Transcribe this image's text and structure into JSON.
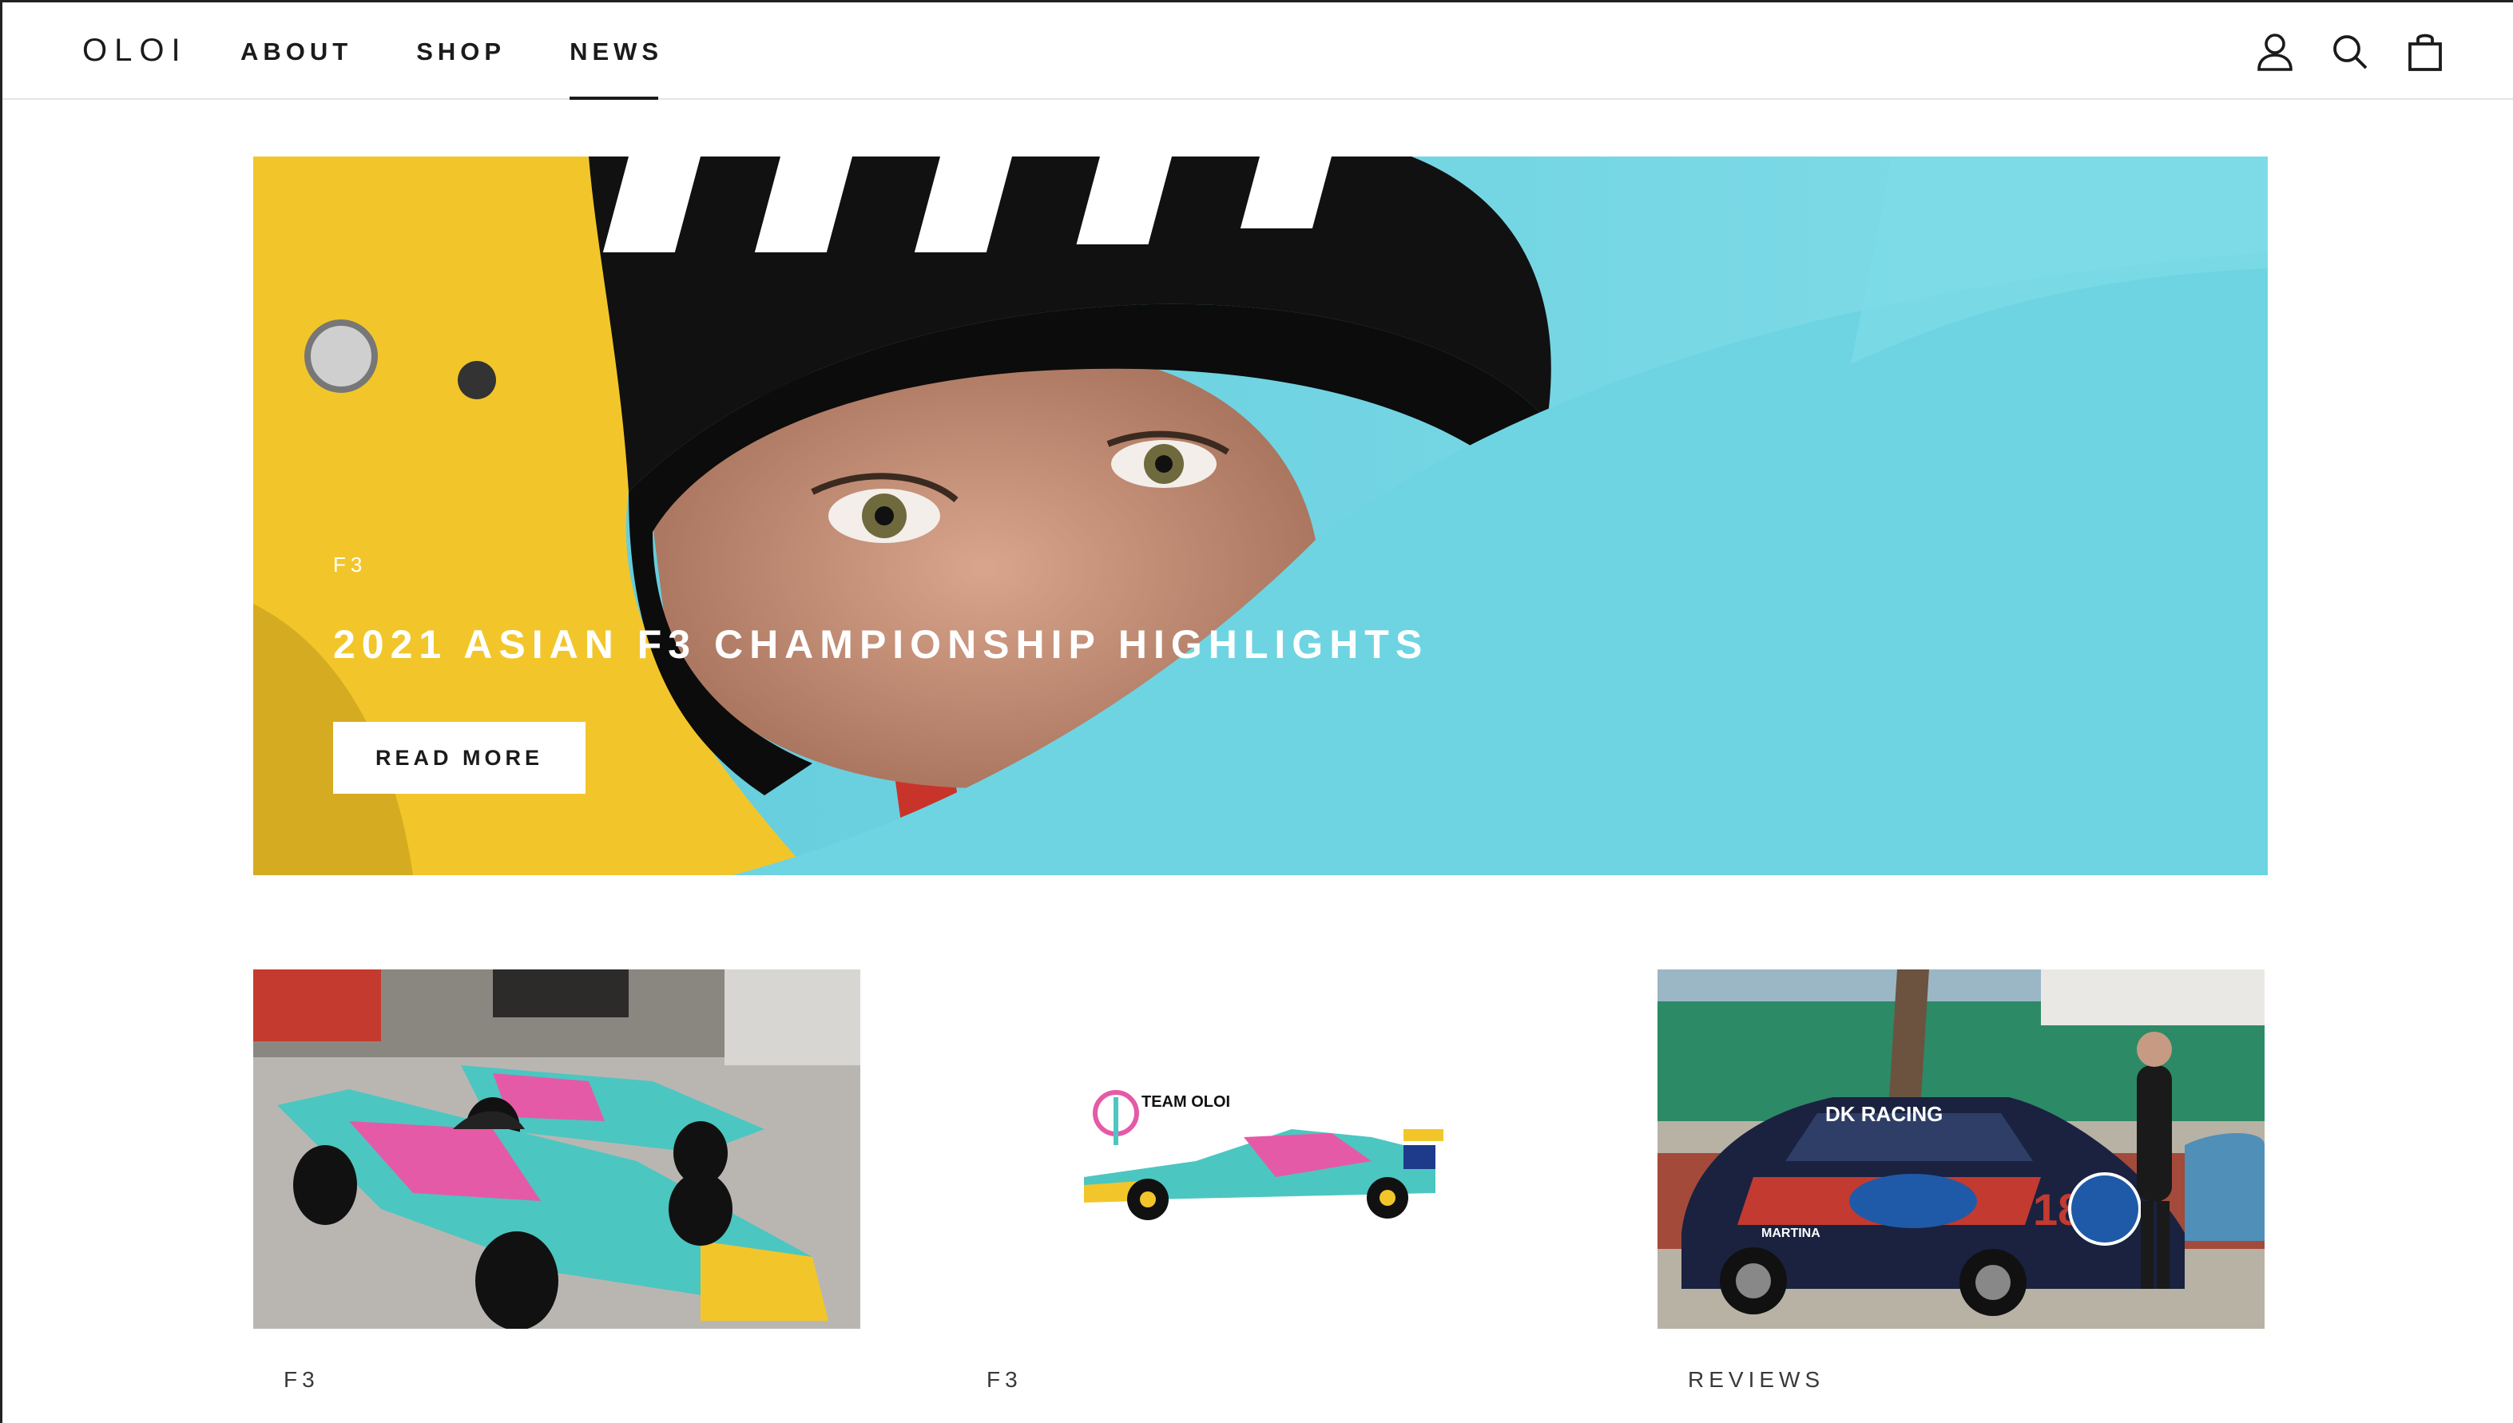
{
  "header": {
    "logo": "OLOI",
    "nav": [
      {
        "label": "ABOUT",
        "active": false
      },
      {
        "label": "SHOP",
        "active": false
      },
      {
        "label": "NEWS",
        "active": true
      }
    ],
    "icons": [
      "account-icon",
      "search-icon",
      "cart-icon"
    ]
  },
  "hero": {
    "tag": "F3",
    "title": "2021 ASIAN F3 CHAMPIONSHIP HIGHLIGHTS",
    "button_label": "READ MORE"
  },
  "cards": [
    {
      "tag": "F3"
    },
    {
      "tag": "F3",
      "image_text": "TEAM OLOI"
    },
    {
      "tag": "REVIEWS",
      "image_text": [
        "DK RACING",
        "18",
        "MARTINA"
      ]
    }
  ],
  "colors": {
    "text": "#1c1b1b",
    "accent_cyan": "#71d6e3",
    "helmet_yellow": "#f2c62a",
    "livery_pink": "#e55aa7",
    "livery_teal": "#4cc6c1"
  }
}
